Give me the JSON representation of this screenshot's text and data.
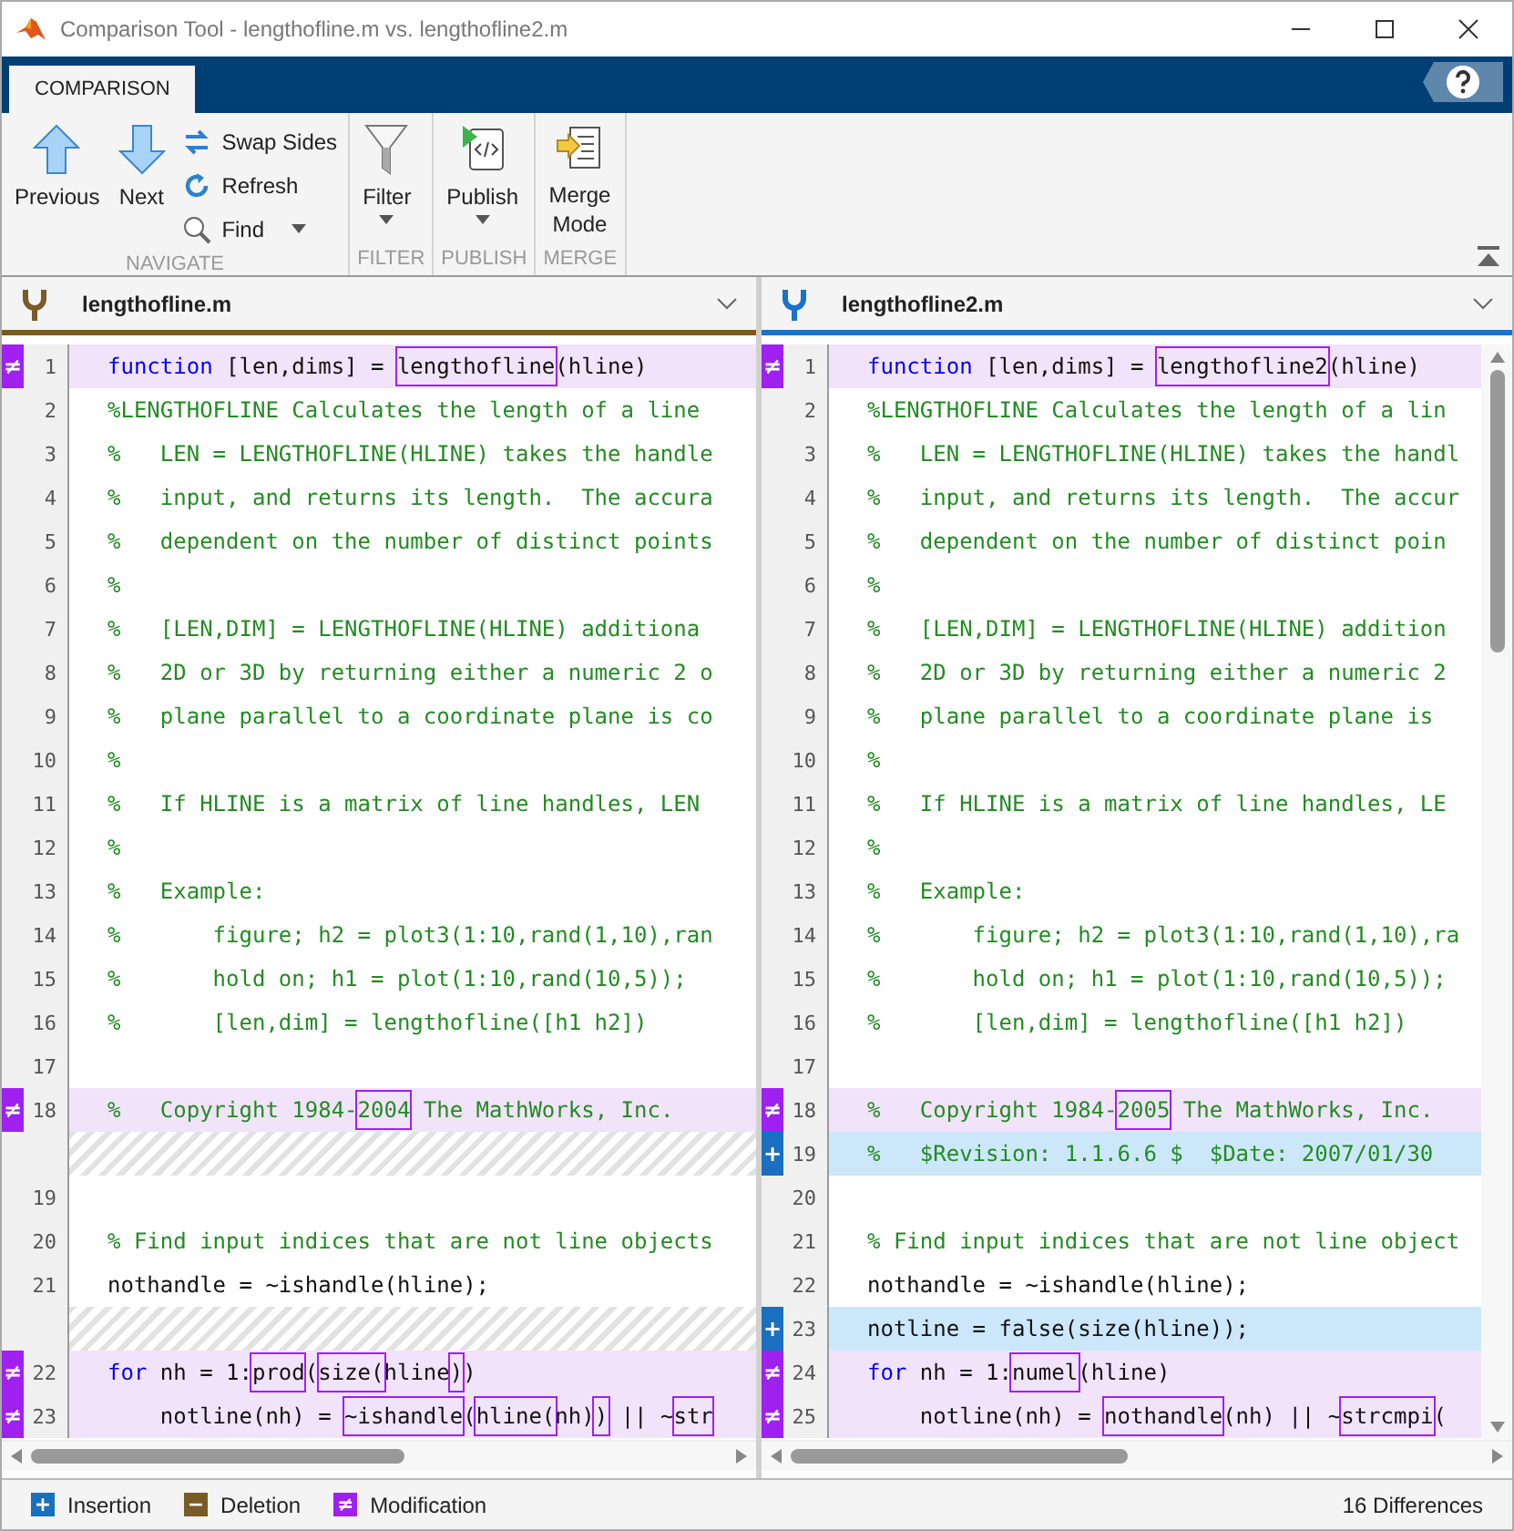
{
  "window": {
    "title": "Comparison Tool - lengthofline.m vs. lengthofline2.m"
  },
  "tabs": [
    {
      "label": "COMPARISON",
      "selected": true
    }
  ],
  "ribbon": {
    "navigate": {
      "label": "NAVIGATE",
      "previous": "Previous",
      "next": "Next",
      "swap_sides": "Swap Sides",
      "refresh": "Refresh",
      "find": "Find"
    },
    "filter": {
      "label": "FILTER",
      "button": "Filter"
    },
    "publish": {
      "label": "PUBLISH",
      "button": "Publish"
    },
    "merge": {
      "label": "MERGE",
      "button_lines": [
        "Merge",
        "Mode"
      ]
    }
  },
  "panes": [
    {
      "file": "lengthofline.m",
      "color": "#7a5a26",
      "rows": [
        {
          "kind": "modified",
          "marker": "≠",
          "number": "1",
          "segments": [
            {
              "text": "function",
              "kind": "keyword"
            },
            {
              "text": " [len,dims] = ",
              "kind": "code"
            },
            {
              "text": "lengthofline",
              "kind": "changed_code"
            },
            {
              "text": "(hline)",
              "kind": "code"
            }
          ]
        },
        {
          "kind": "same",
          "number": "2",
          "segments": [
            {
              "text": "%LENGTHOFLINE Calculates the length of a line",
              "kind": "comment"
            }
          ]
        },
        {
          "kind": "same",
          "number": "3",
          "segments": [
            {
              "text": "%   LEN = LENGTHOFLINE(HLINE) takes the handle",
              "kind": "comment"
            }
          ]
        },
        {
          "kind": "same",
          "number": "4",
          "segments": [
            {
              "text": "%   input, and returns its length.  The accura",
              "kind": "comment"
            }
          ]
        },
        {
          "kind": "same",
          "number": "5",
          "segments": [
            {
              "text": "%   dependent on the number of distinct points",
              "kind": "comment"
            }
          ]
        },
        {
          "kind": "same",
          "number": "6",
          "segments": [
            {
              "text": "%",
              "kind": "comment"
            }
          ]
        },
        {
          "kind": "same",
          "number": "7",
          "segments": [
            {
              "text": "%   [LEN,DIM] = LENGTHOFLINE(HLINE) additiona",
              "kind": "comment"
            }
          ]
        },
        {
          "kind": "same",
          "number": "8",
          "segments": [
            {
              "text": "%   2D or 3D by returning either a numeric 2 o",
              "kind": "comment"
            }
          ]
        },
        {
          "kind": "same",
          "number": "9",
          "segments": [
            {
              "text": "%   plane parallel to a coordinate plane is co",
              "kind": "comment"
            }
          ]
        },
        {
          "kind": "same",
          "number": "10",
          "segments": [
            {
              "text": "%",
              "kind": "comment"
            }
          ]
        },
        {
          "kind": "same",
          "number": "11",
          "segments": [
            {
              "text": "%   If HLINE is a matrix of line handles, LEN",
              "kind": "comment"
            }
          ]
        },
        {
          "kind": "same",
          "number": "12",
          "segments": [
            {
              "text": "%",
              "kind": "comment"
            }
          ]
        },
        {
          "kind": "same",
          "number": "13",
          "segments": [
            {
              "text": "%   Example:",
              "kind": "comment"
            }
          ]
        },
        {
          "kind": "same",
          "number": "14",
          "segments": [
            {
              "text": "%       figure; h2 = plot3(1:10,rand(1,10),ran",
              "kind": "comment"
            }
          ]
        },
        {
          "kind": "same",
          "number": "15",
          "segments": [
            {
              "text": "%       hold on; h1 = plot(1:10,rand(10,5));",
              "kind": "comment"
            }
          ]
        },
        {
          "kind": "same",
          "number": "16",
          "segments": [
            {
              "text": "%       [len,dim] = lengthofline([h1 h2])",
              "kind": "comment"
            }
          ]
        },
        {
          "kind": "same",
          "number": "17"
        },
        {
          "kind": "modified",
          "marker": "≠",
          "number": "18",
          "segments": [
            {
              "text": "%   Copyright 1984-",
              "kind": "comment"
            },
            {
              "text": "2004",
              "kind": "changed_comment"
            },
            {
              "text": " The MathWorks, Inc.",
              "kind": "comment"
            }
          ]
        },
        {
          "kind": "placeholder"
        },
        {
          "kind": "same",
          "number": "19"
        },
        {
          "kind": "same",
          "number": "20",
          "segments": [
            {
              "text": "% Find input indices that are not line objects",
              "kind": "comment"
            }
          ]
        },
        {
          "kind": "same",
          "number": "21",
          "segments": [
            {
              "text": "nothandle = ~ishandle(hline);",
              "kind": "code"
            }
          ]
        },
        {
          "kind": "placeholder"
        },
        {
          "kind": "modified",
          "marker": "≠",
          "number": "22",
          "segments": [
            {
              "text": "for",
              "kind": "keyword"
            },
            {
              "text": " nh = 1:",
              "kind": "code"
            },
            {
              "text": "prod",
              "kind": "changed_code"
            },
            {
              "text": "(",
              "kind": "code"
            },
            {
              "text": "size(",
              "kind": "changed_code"
            },
            {
              "text": "hline",
              "kind": "code"
            },
            {
              "text": ")",
              "kind": "changed_code"
            },
            {
              "text": ")",
              "kind": "code"
            }
          ]
        },
        {
          "kind": "modified",
          "marker": "≠",
          "number": "23",
          "segments": [
            {
              "text": "    notline(nh) = ",
              "kind": "code"
            },
            {
              "text": "~ishandle",
              "kind": "changed_code"
            },
            {
              "text": "(",
              "kind": "code"
            },
            {
              "text": "hline(",
              "kind": "changed_code"
            },
            {
              "text": "nh)",
              "kind": "code"
            },
            {
              "text": ")",
              "kind": "changed_code"
            },
            {
              "text": " || ~",
              "kind": "code"
            },
            {
              "text": "str",
              "kind": "changed_code"
            }
          ]
        }
      ]
    },
    {
      "file": "lengthofline2.m",
      "color": "#1a73c8",
      "rows": [
        {
          "kind": "modified",
          "marker": "≠",
          "number": "1",
          "segments": [
            {
              "text": "function",
              "kind": "keyword"
            },
            {
              "text": " [len,dims] = ",
              "kind": "code"
            },
            {
              "text": "lengthofline2",
              "kind": "changed_code"
            },
            {
              "text": "(hline)",
              "kind": "code"
            }
          ]
        },
        {
          "kind": "same",
          "number": "2",
          "segments": [
            {
              "text": "%LENGTHOFLINE Calculates the length of a lin",
              "kind": "comment"
            }
          ]
        },
        {
          "kind": "same",
          "number": "3",
          "segments": [
            {
              "text": "%   LEN = LENGTHOFLINE(HLINE) takes the handl",
              "kind": "comment"
            }
          ]
        },
        {
          "kind": "same",
          "number": "4",
          "segments": [
            {
              "text": "%   input, and returns its length.  The accur",
              "kind": "comment"
            }
          ]
        },
        {
          "kind": "same",
          "number": "5",
          "segments": [
            {
              "text": "%   dependent on the number of distinct poin",
              "kind": "comment"
            }
          ]
        },
        {
          "kind": "same",
          "number": "6",
          "segments": [
            {
              "text": "%",
              "kind": "comment"
            }
          ]
        },
        {
          "kind": "same",
          "number": "7",
          "segments": [
            {
              "text": "%   [LEN,DIM] = LENGTHOFLINE(HLINE) addition",
              "kind": "comment"
            }
          ]
        },
        {
          "kind": "same",
          "number": "8",
          "segments": [
            {
              "text": "%   2D or 3D by returning either a numeric 2",
              "kind": "comment"
            }
          ]
        },
        {
          "kind": "same",
          "number": "9",
          "segments": [
            {
              "text": "%   plane parallel to a coordinate plane is",
              "kind": "comment"
            }
          ]
        },
        {
          "kind": "same",
          "number": "10",
          "segments": [
            {
              "text": "%",
              "kind": "comment"
            }
          ]
        },
        {
          "kind": "same",
          "number": "11",
          "segments": [
            {
              "text": "%   If HLINE is a matrix of line handles, LE",
              "kind": "comment"
            }
          ]
        },
        {
          "kind": "same",
          "number": "12",
          "segments": [
            {
              "text": "%",
              "kind": "comment"
            }
          ]
        },
        {
          "kind": "same",
          "number": "13",
          "segments": [
            {
              "text": "%   Example:",
              "kind": "comment"
            }
          ]
        },
        {
          "kind": "same",
          "number": "14",
          "segments": [
            {
              "text": "%       figure; h2 = plot3(1:10,rand(1,10),ra",
              "kind": "comment"
            }
          ]
        },
        {
          "kind": "same",
          "number": "15",
          "segments": [
            {
              "text": "%       hold on; h1 = plot(1:10,rand(10,5));",
              "kind": "comment"
            }
          ]
        },
        {
          "kind": "same",
          "number": "16",
          "segments": [
            {
              "text": "%       [len,dim] = lengthofline([h1 h2])",
              "kind": "comment"
            }
          ]
        },
        {
          "kind": "same",
          "number": "17"
        },
        {
          "kind": "modified",
          "marker": "≠",
          "number": "18",
          "segments": [
            {
              "text": "%   Copyright 1984-",
              "kind": "comment"
            },
            {
              "text": "2005",
              "kind": "changed_comment"
            },
            {
              "text": " The MathWorks, Inc.",
              "kind": "comment"
            }
          ]
        },
        {
          "kind": "inserted",
          "marker": "+",
          "number": "19",
          "segments": [
            {
              "text": "%   $Revision: 1.1.6.6 $  $Date: 2007/01/30",
              "kind": "comment"
            }
          ]
        },
        {
          "kind": "same",
          "number": "20"
        },
        {
          "kind": "same",
          "number": "21",
          "segments": [
            {
              "text": "% Find input indices that are not line object",
              "kind": "comment"
            }
          ]
        },
        {
          "kind": "same",
          "number": "22",
          "segments": [
            {
              "text": "nothandle = ~ishandle(hline);",
              "kind": "code"
            }
          ]
        },
        {
          "kind": "inserted",
          "marker": "+",
          "number": "23",
          "segments": [
            {
              "text": "notline = false(size(hline));",
              "kind": "code"
            }
          ]
        },
        {
          "kind": "modified",
          "marker": "≠",
          "number": "24",
          "segments": [
            {
              "text": "for",
              "kind": "keyword"
            },
            {
              "text": " nh = 1:",
              "kind": "code"
            },
            {
              "text": "numel",
              "kind": "changed_code"
            },
            {
              "text": "(hline)",
              "kind": "code"
            }
          ]
        },
        {
          "kind": "modified",
          "marker": "≠",
          "number": "25",
          "segments": [
            {
              "text": "    notline(nh) = ",
              "kind": "code"
            },
            {
              "text": "nothandle",
              "kind": "changed_code"
            },
            {
              "text": "(nh) || ~",
              "kind": "code"
            },
            {
              "text": "strcmpi",
              "kind": "changed_code"
            },
            {
              "text": "(",
              "kind": "code"
            }
          ]
        }
      ]
    }
  ],
  "legend": [
    {
      "glyph": "+",
      "label": "Insertion",
      "color": "#1a6fc0"
    },
    {
      "glyph": "−",
      "label": "Deletion",
      "color": "#7a5a26"
    },
    {
      "glyph": "≠",
      "label": "Modification",
      "color": "#a020f0"
    }
  ],
  "status": "16 Differences"
}
